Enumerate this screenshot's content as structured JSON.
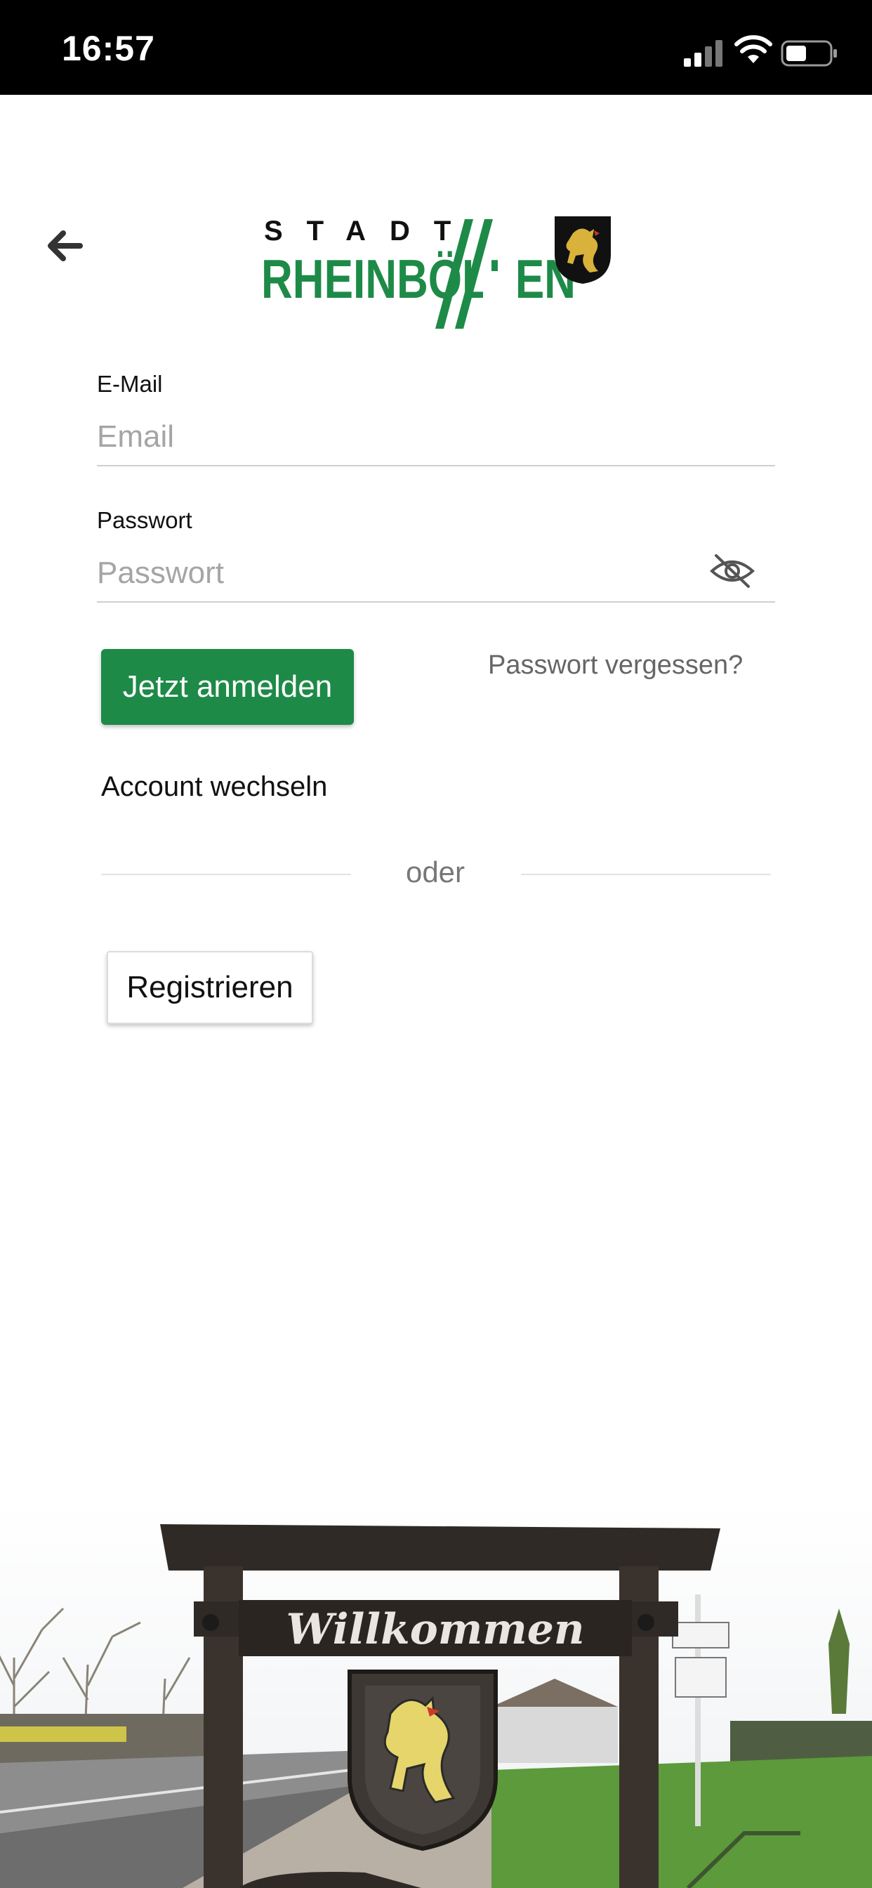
{
  "status_bar": {
    "time": "16:57"
  },
  "header": {
    "logo_top": "STADT",
    "logo_name_1": "RHEINB",
    "logo_name_2": "Ö",
    "logo_name_3": "LLEN"
  },
  "form": {
    "email_label": "E-Mail",
    "email_placeholder": "Email",
    "password_label": "Passwort",
    "password_placeholder": "Passwort",
    "login_button": "Jetzt anmelden",
    "forgot_password": "Passwort vergessen?",
    "switch_account": "Account wechseln",
    "divider_text": "oder",
    "register_button": "Registrieren"
  },
  "photo": {
    "sign_text": "Willkommen"
  },
  "colors": {
    "brand_green": "#1e8a48",
    "status_bar": "#000000"
  }
}
